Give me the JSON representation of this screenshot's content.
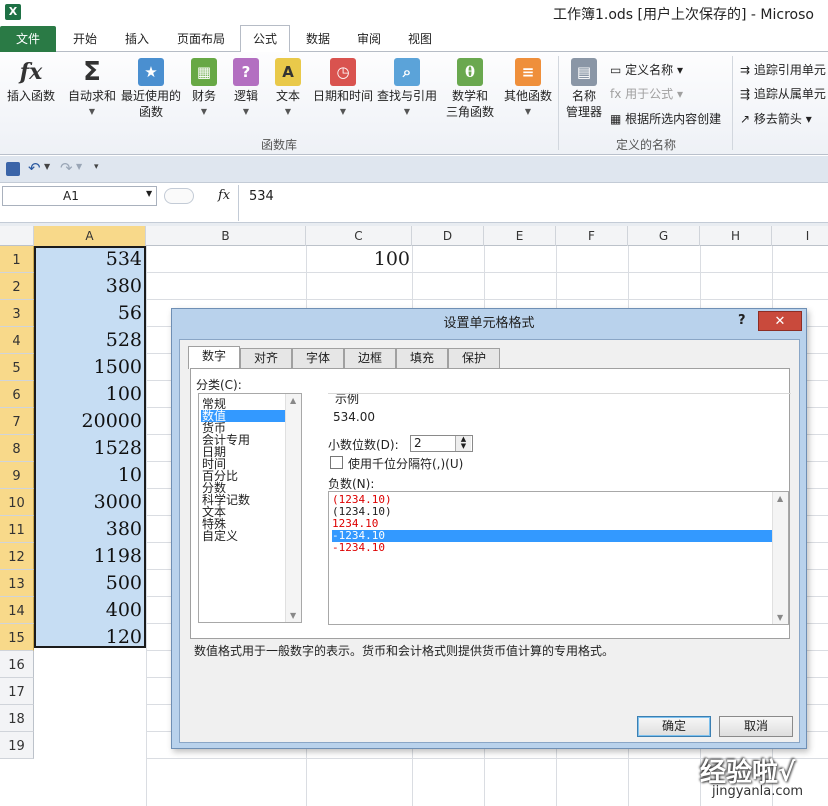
{
  "window": {
    "title": "工作簿1.ods [用户上次保存的] - Microso",
    "app_icon": "X"
  },
  "ribbon_tabs": [
    "文件",
    "开始",
    "插入",
    "页面布局",
    "公式",
    "数据",
    "审阅",
    "视图"
  ],
  "ribbon": {
    "function_library": {
      "label": "函数库",
      "buttons": [
        {
          "label": "插入函数",
          "icon": "fx",
          "dropdown": false
        },
        {
          "label": "自动求和",
          "icon": "Σ",
          "dropdown": true
        },
        {
          "label": "最近使用的\n函数",
          "icon": "★",
          "dropdown": true
        },
        {
          "label": "财务",
          "icon": "▦",
          "dropdown": true
        },
        {
          "label": "逻辑",
          "icon": "?",
          "dropdown": true
        },
        {
          "label": "文本",
          "icon": "A",
          "dropdown": true
        },
        {
          "label": "日期和时间",
          "icon": "◷",
          "dropdown": true
        },
        {
          "label": "查找与引用",
          "icon": "⌕",
          "dropdown": true
        },
        {
          "label": "数学和\n三角函数",
          "icon": "θ",
          "dropdown": true
        },
        {
          "label": "其他函数",
          "icon": "≡",
          "dropdown": true
        }
      ]
    },
    "defined_names": {
      "label": "定义的名称",
      "manager_label": "名称\n管理器",
      "define_name": "定义名称",
      "use_in_formula": "用于公式",
      "create_from_selection": "根据所选内容创建"
    },
    "formula_auditing": {
      "trace_precedents": "追踪引用单元",
      "trace_dependents": "追踪从属单元",
      "remove_arrows": "移去箭头"
    }
  },
  "qat": {
    "save": "save-icon",
    "undo": "undo-icon",
    "redo": "redo-icon"
  },
  "formula_bar": {
    "name_box": "A1",
    "fx": "fx",
    "value": "534"
  },
  "columns": [
    "A",
    "B",
    "C",
    "D",
    "E",
    "F",
    "G",
    "H",
    "I"
  ],
  "rows": [
    "1",
    "2",
    "3",
    "4",
    "5",
    "6",
    "7",
    "8",
    "9",
    "10",
    "11",
    "12",
    "13",
    "14",
    "15",
    "16",
    "17",
    "18",
    "19"
  ],
  "column_a_values": [
    "534",
    "380",
    "56",
    "528",
    "1500",
    "100",
    "20000",
    "1528",
    "10",
    "3000",
    "380",
    "1198",
    "500",
    "400",
    "120"
  ],
  "cell_c1": "100",
  "dialog": {
    "title": "设置单元格格式",
    "help": "?",
    "close": "✕",
    "tabs": [
      "数字",
      "对齐",
      "字体",
      "边框",
      "填充",
      "保护"
    ],
    "category_label": "分类(C):",
    "categories": [
      "常规",
      "数值",
      "货币",
      "会计专用",
      "日期",
      "时间",
      "百分比",
      "分数",
      "科学记数",
      "文本",
      "特殊",
      "自定义"
    ],
    "selected_category": "数值",
    "sample_label": "示例",
    "sample_value": "534.00",
    "decimal_label": "小数位数(D):",
    "decimal_value": "2",
    "thousands_label": "使用千位分隔符(,)(U)",
    "negative_label": "负数(N):",
    "negative_formats": [
      {
        "text": "(1234.10)",
        "red": true
      },
      {
        "text": "(1234.10)",
        "red": false
      },
      {
        "text": "1234.10",
        "red": true
      },
      {
        "text": "-1234.10",
        "red": false,
        "selected": true
      },
      {
        "text": "-1234.10",
        "red": true
      }
    ],
    "description": "数值格式用于一般数字的表示。货币和会计格式则提供货币值计算的专用格式。",
    "ok": "确定",
    "cancel": "取消"
  },
  "watermark": {
    "text": "经验啦√",
    "url": "jingyanla.com"
  }
}
